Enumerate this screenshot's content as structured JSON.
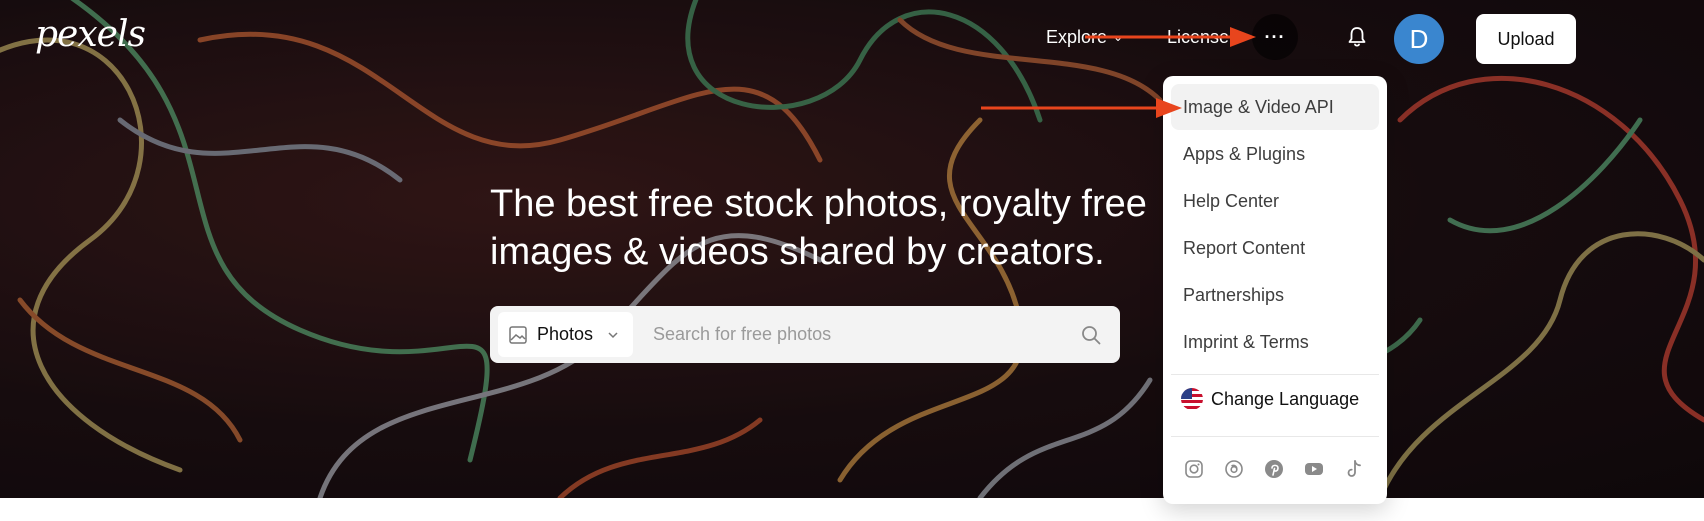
{
  "header": {
    "logo": "pexels",
    "nav": {
      "explore": "Explore",
      "license": "License"
    },
    "more_label": "···",
    "avatar_letter": "D",
    "upload_label": "Upload"
  },
  "hero": {
    "headline": "The best free stock photos, royalty free images & videos shared by creators."
  },
  "search": {
    "type": "Photos",
    "placeholder": "Search for free photos"
  },
  "menu": {
    "items": [
      {
        "label": "Image & Video API"
      },
      {
        "label": "Apps & Plugins"
      },
      {
        "label": "Help Center"
      },
      {
        "label": "Report Content"
      },
      {
        "label": "Partnerships"
      },
      {
        "label": "Imprint & Terms"
      }
    ],
    "language": "Change Language",
    "socials": [
      "instagram-icon",
      "threads-icon",
      "pinterest-icon",
      "youtube-icon",
      "tiktok-icon"
    ]
  },
  "colors": {
    "annotation_arrow": "#e8451d",
    "avatar_bg": "#3a86cf",
    "menu_active_bg": "#f2f2f2"
  }
}
